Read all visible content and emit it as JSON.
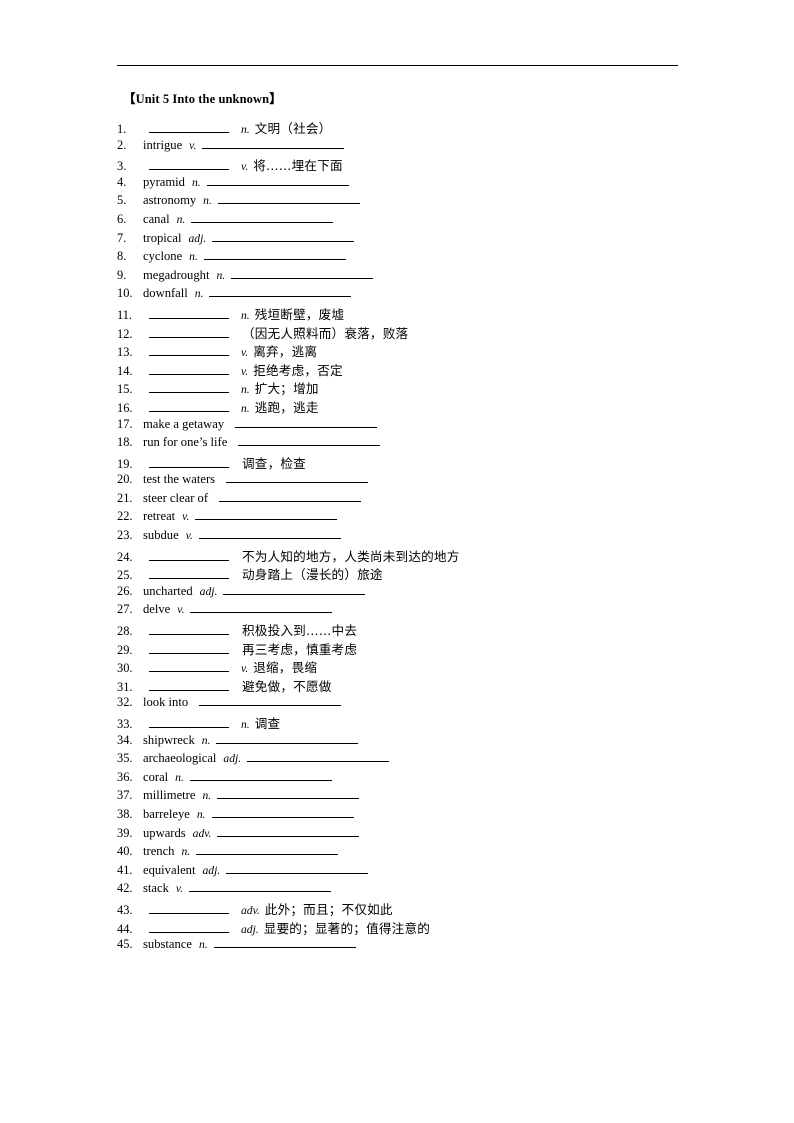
{
  "document": {
    "title": "【Unit 5 Into the unknown】",
    "header_rule": true
  },
  "entries": [
    {
      "num": "1.",
      "layout": "blank-first",
      "term": "",
      "pos": "n.",
      "definition": "文明（社会）"
    },
    {
      "num": "2.",
      "layout": "term-first",
      "term": "intrigue",
      "pos": "v.",
      "definition": ""
    },
    {
      "num": "3.",
      "layout": "blank-first",
      "term": "",
      "pos": "v.",
      "definition": "将……埋在下面"
    },
    {
      "num": "4.",
      "layout": "term-first",
      "term": "pyramid",
      "pos": "n.",
      "definition": ""
    },
    {
      "num": "5.",
      "layout": "term-first",
      "term": "astronomy",
      "pos": "n.",
      "definition": ""
    },
    {
      "num": "6.",
      "layout": "term-first",
      "term": "canal",
      "pos": "n.",
      "definition": ""
    },
    {
      "num": "7.",
      "layout": "term-first",
      "term": "tropical",
      "pos": "adj.",
      "definition": ""
    },
    {
      "num": "8.",
      "layout": "term-first",
      "term": "cyclone",
      "pos": "n.",
      "definition": ""
    },
    {
      "num": "9.",
      "layout": "term-first",
      "term": "megadrought",
      "pos": "n.",
      "definition": ""
    },
    {
      "num": "10.",
      "layout": "term-first",
      "term": "downfall",
      "pos": "n.",
      "definition": ""
    },
    {
      "num": "11.",
      "layout": "blank-first",
      "term": "",
      "pos": "n.",
      "definition": "残垣断壁，废墟"
    },
    {
      "num": "12.",
      "layout": "blank-first",
      "term": "",
      "pos": "",
      "definition": "（因无人照料而）衰落，败落"
    },
    {
      "num": "13.",
      "layout": "blank-first",
      "term": "",
      "pos": "v.",
      "definition": "离弃，逃离"
    },
    {
      "num": "14.",
      "layout": "blank-first",
      "term": "",
      "pos": "v.",
      "definition": "拒绝考虑，否定"
    },
    {
      "num": "15.",
      "layout": "blank-first",
      "term": "",
      "pos": "n.",
      "definition": "扩大；增加"
    },
    {
      "num": "16.",
      "layout": "blank-first",
      "term": "",
      "pos": "n.",
      "definition": "逃跑，逃走"
    },
    {
      "num": "17.",
      "layout": "term-first",
      "term": "make a getaway",
      "pos": "",
      "definition": ""
    },
    {
      "num": "18.",
      "layout": "term-first",
      "term": "run for one’s life",
      "pos": "",
      "definition": ""
    },
    {
      "num": "19.",
      "layout": "blank-first",
      "term": "",
      "pos": "",
      "definition": "调查，检查"
    },
    {
      "num": "20.",
      "layout": "term-first",
      "term": "test the waters",
      "pos": "",
      "definition": ""
    },
    {
      "num": "21.",
      "layout": "term-first",
      "term": "steer clear of",
      "pos": "",
      "definition": ""
    },
    {
      "num": "22.",
      "layout": "term-first",
      "term": "retreat",
      "pos": "v.",
      "definition": ""
    },
    {
      "num": "23.",
      "layout": "term-first",
      "term": "subdue",
      "pos": "v.",
      "definition": ""
    },
    {
      "num": "24.",
      "layout": "blank-first",
      "term": "",
      "pos": "",
      "definition": "不为人知的地方，人类尚未到达的地方"
    },
    {
      "num": "25.",
      "layout": "blank-first",
      "term": "",
      "pos": "",
      "definition": "动身踏上（漫长的）旅途"
    },
    {
      "num": "26.",
      "layout": "term-first",
      "term": "uncharted",
      "pos": "adj.",
      "definition": ""
    },
    {
      "num": "27.",
      "layout": "term-first",
      "term": "delve",
      "pos": "v.",
      "definition": ""
    },
    {
      "num": "28.",
      "layout": "blank-first",
      "term": "",
      "pos": "",
      "definition": "积极投入到……中去"
    },
    {
      "num": "29.",
      "layout": "blank-first",
      "term": "",
      "pos": "",
      "definition": "再三考虑，慎重考虑"
    },
    {
      "num": "30.",
      "layout": "blank-first",
      "term": "",
      "pos": "v.",
      "definition": "退缩，畏缩"
    },
    {
      "num": "31.",
      "layout": "blank-first",
      "term": "",
      "pos": "",
      "definition": "避免做，不愿做"
    },
    {
      "num": "32.",
      "layout": "term-first",
      "term": "look into",
      "pos": "",
      "definition": ""
    },
    {
      "num": "33.",
      "layout": "blank-first",
      "term": "",
      "pos": "n.",
      "definition": "调查"
    },
    {
      "num": "34.",
      "layout": "term-first",
      "term": "shipwreck",
      "pos": "n.",
      "definition": ""
    },
    {
      "num": "35.",
      "layout": "term-first",
      "term": "archaeological",
      "pos": "adj.",
      "definition": ""
    },
    {
      "num": "36.",
      "layout": "term-first",
      "term": "coral",
      "pos": "n.",
      "definition": ""
    },
    {
      "num": "37.",
      "layout": "term-first",
      "term": "millimetre",
      "pos": "n.",
      "definition": ""
    },
    {
      "num": "38.",
      "layout": "term-first",
      "term": "barreleye",
      "pos": "n.",
      "definition": ""
    },
    {
      "num": "39.",
      "layout": "term-first",
      "term": "upwards",
      "pos": "adv.",
      "definition": ""
    },
    {
      "num": "40.",
      "layout": "term-first",
      "term": "trench",
      "pos": "n.",
      "definition": ""
    },
    {
      "num": "41.",
      "layout": "term-first",
      "term": "equivalent",
      "pos": "adj.",
      "definition": ""
    },
    {
      "num": "42.",
      "layout": "term-first",
      "term": "stack",
      "pos": "v.",
      "definition": ""
    },
    {
      "num": "43.",
      "layout": "blank-first",
      "term": "",
      "pos": "adv.",
      "definition": "此外；而且；不仅如此"
    },
    {
      "num": "44.",
      "layout": "blank-first",
      "term": "",
      "pos": "adj.",
      "definition": "显要的；显著的；值得注意的"
    },
    {
      "num": "45.",
      "layout": "term-first",
      "term": "substance",
      "pos": "n.",
      "definition": ""
    }
  ]
}
